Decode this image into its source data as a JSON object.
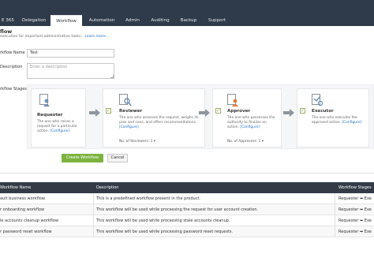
{
  "nav": {
    "items": [
      {
        "label": "E 365"
      },
      {
        "label": "Delegation"
      },
      {
        "label": "Workflow"
      },
      {
        "label": "Automation"
      },
      {
        "label": "Admin"
      },
      {
        "label": "Auditing"
      },
      {
        "label": "Backup"
      },
      {
        "label": "Support"
      }
    ],
    "active_index": 2
  },
  "header": {
    "title": "flow",
    "subtitle": "execution for important administrative tasks.",
    "learn_more": "Learn more..."
  },
  "form": {
    "name_label": "rkflow Name",
    "name_value": "Test",
    "description_label": "Description",
    "description_placeholder": "Enter a description",
    "stages_label": "rkflow Stages"
  },
  "stages": [
    {
      "icon": "requester-icon",
      "title": "Requester",
      "desc": "The one who raises a request for a particular action.",
      "configure": "[Configure]"
    },
    {
      "icon": "reviewer-icon",
      "title": "Reviewer",
      "desc": "The one who assesses the request, weighs its pros and cons, and offers recommendations.",
      "configure": "[Configure]",
      "count": "No. of Reviewers: 1 ▾"
    },
    {
      "icon": "approver-icon",
      "title": "Approver",
      "desc": "The one who possesses the authority to finalize an action.",
      "configure": "[Configure]",
      "count": "No. of Approvers: 1 ▾"
    },
    {
      "icon": "executor-icon",
      "title": "Executor",
      "desc": "The one who executes the approved action.",
      "configure": "[Configure]"
    }
  ],
  "buttons": {
    "create": "Create Workflow",
    "cancel": "Cancel"
  },
  "table": {
    "headers": [
      "Workflow Name",
      "Description",
      "Workflow Stages"
    ],
    "rows": [
      {
        "name": "ault business workflow",
        "description": "This is a predefined workflow present in the product.",
        "stages": "Requester ➡ Exe"
      },
      {
        "name": "r onboarding workflow",
        "description": "This workflow will be used while processing the request for user account creation.",
        "stages": "Requester ➡ Exe"
      },
      {
        "name": "le accounts cleanup workflow",
        "description": "This workflow will be used while processing stale accounts cleanup.",
        "stages": "Requester ➡ Exe"
      },
      {
        "name": "r password reset workflow",
        "description": "This workflow will be used while processing password reset requests.",
        "stages": "Requester ➡ Exe"
      }
    ]
  },
  "colors": {
    "nav_bg": "#2f3a4a",
    "accent_green": "#7bb33e",
    "link_blue": "#1a6fc9",
    "table_header": "#323b46"
  }
}
